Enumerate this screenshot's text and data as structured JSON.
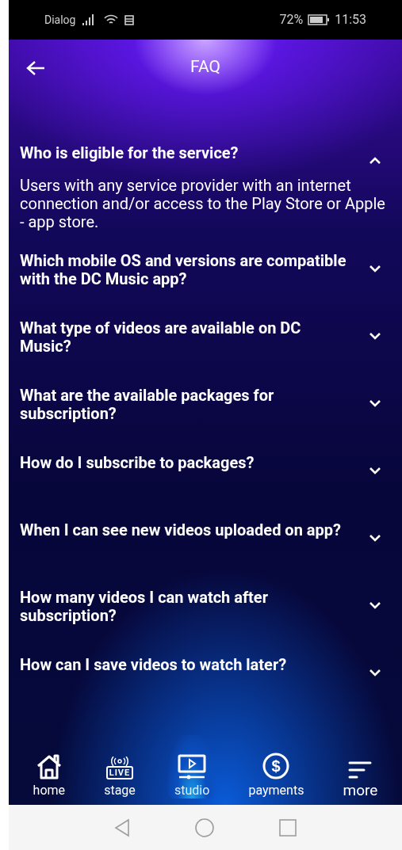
{
  "status_bar": {
    "carrier": "Dialog",
    "battery": "72%",
    "time": "11:53"
  },
  "header": {
    "title": "FAQ"
  },
  "faq": [
    {
      "question": "Who is eligible for the service?",
      "expanded": true,
      "answer": "Users with any service provider with an internet connection and/or access to the Play Store or Apple - app store."
    },
    {
      "question": "Which mobile OS and versions are compatible with the DC Music app?",
      "expanded": false
    },
    {
      "question": "What type of videos are available on DC Music?",
      "expanded": false
    },
    {
      "question": "What are the available packages for subscription?",
      "expanded": false
    },
    {
      "question": "How do I subscribe to packages?",
      "expanded": false
    },
    {
      "question": "When I can see new videos uploaded on app?",
      "expanded": false
    },
    {
      "question": "How many videos I can watch after subscription?",
      "expanded": false
    },
    {
      "question": "How can I save videos to watch later?",
      "expanded": false
    }
  ],
  "nav": [
    {
      "kind": "home",
      "label": "home",
      "selected": false
    },
    {
      "kind": "live",
      "label": "stage",
      "icon_text": "LIVE",
      "selected": false
    },
    {
      "kind": "studio",
      "label": "studio",
      "selected": true
    },
    {
      "kind": "payments",
      "label": "payments",
      "icon_text": "$",
      "selected": false
    },
    {
      "kind": "more",
      "label": "more",
      "selected": false
    }
  ]
}
